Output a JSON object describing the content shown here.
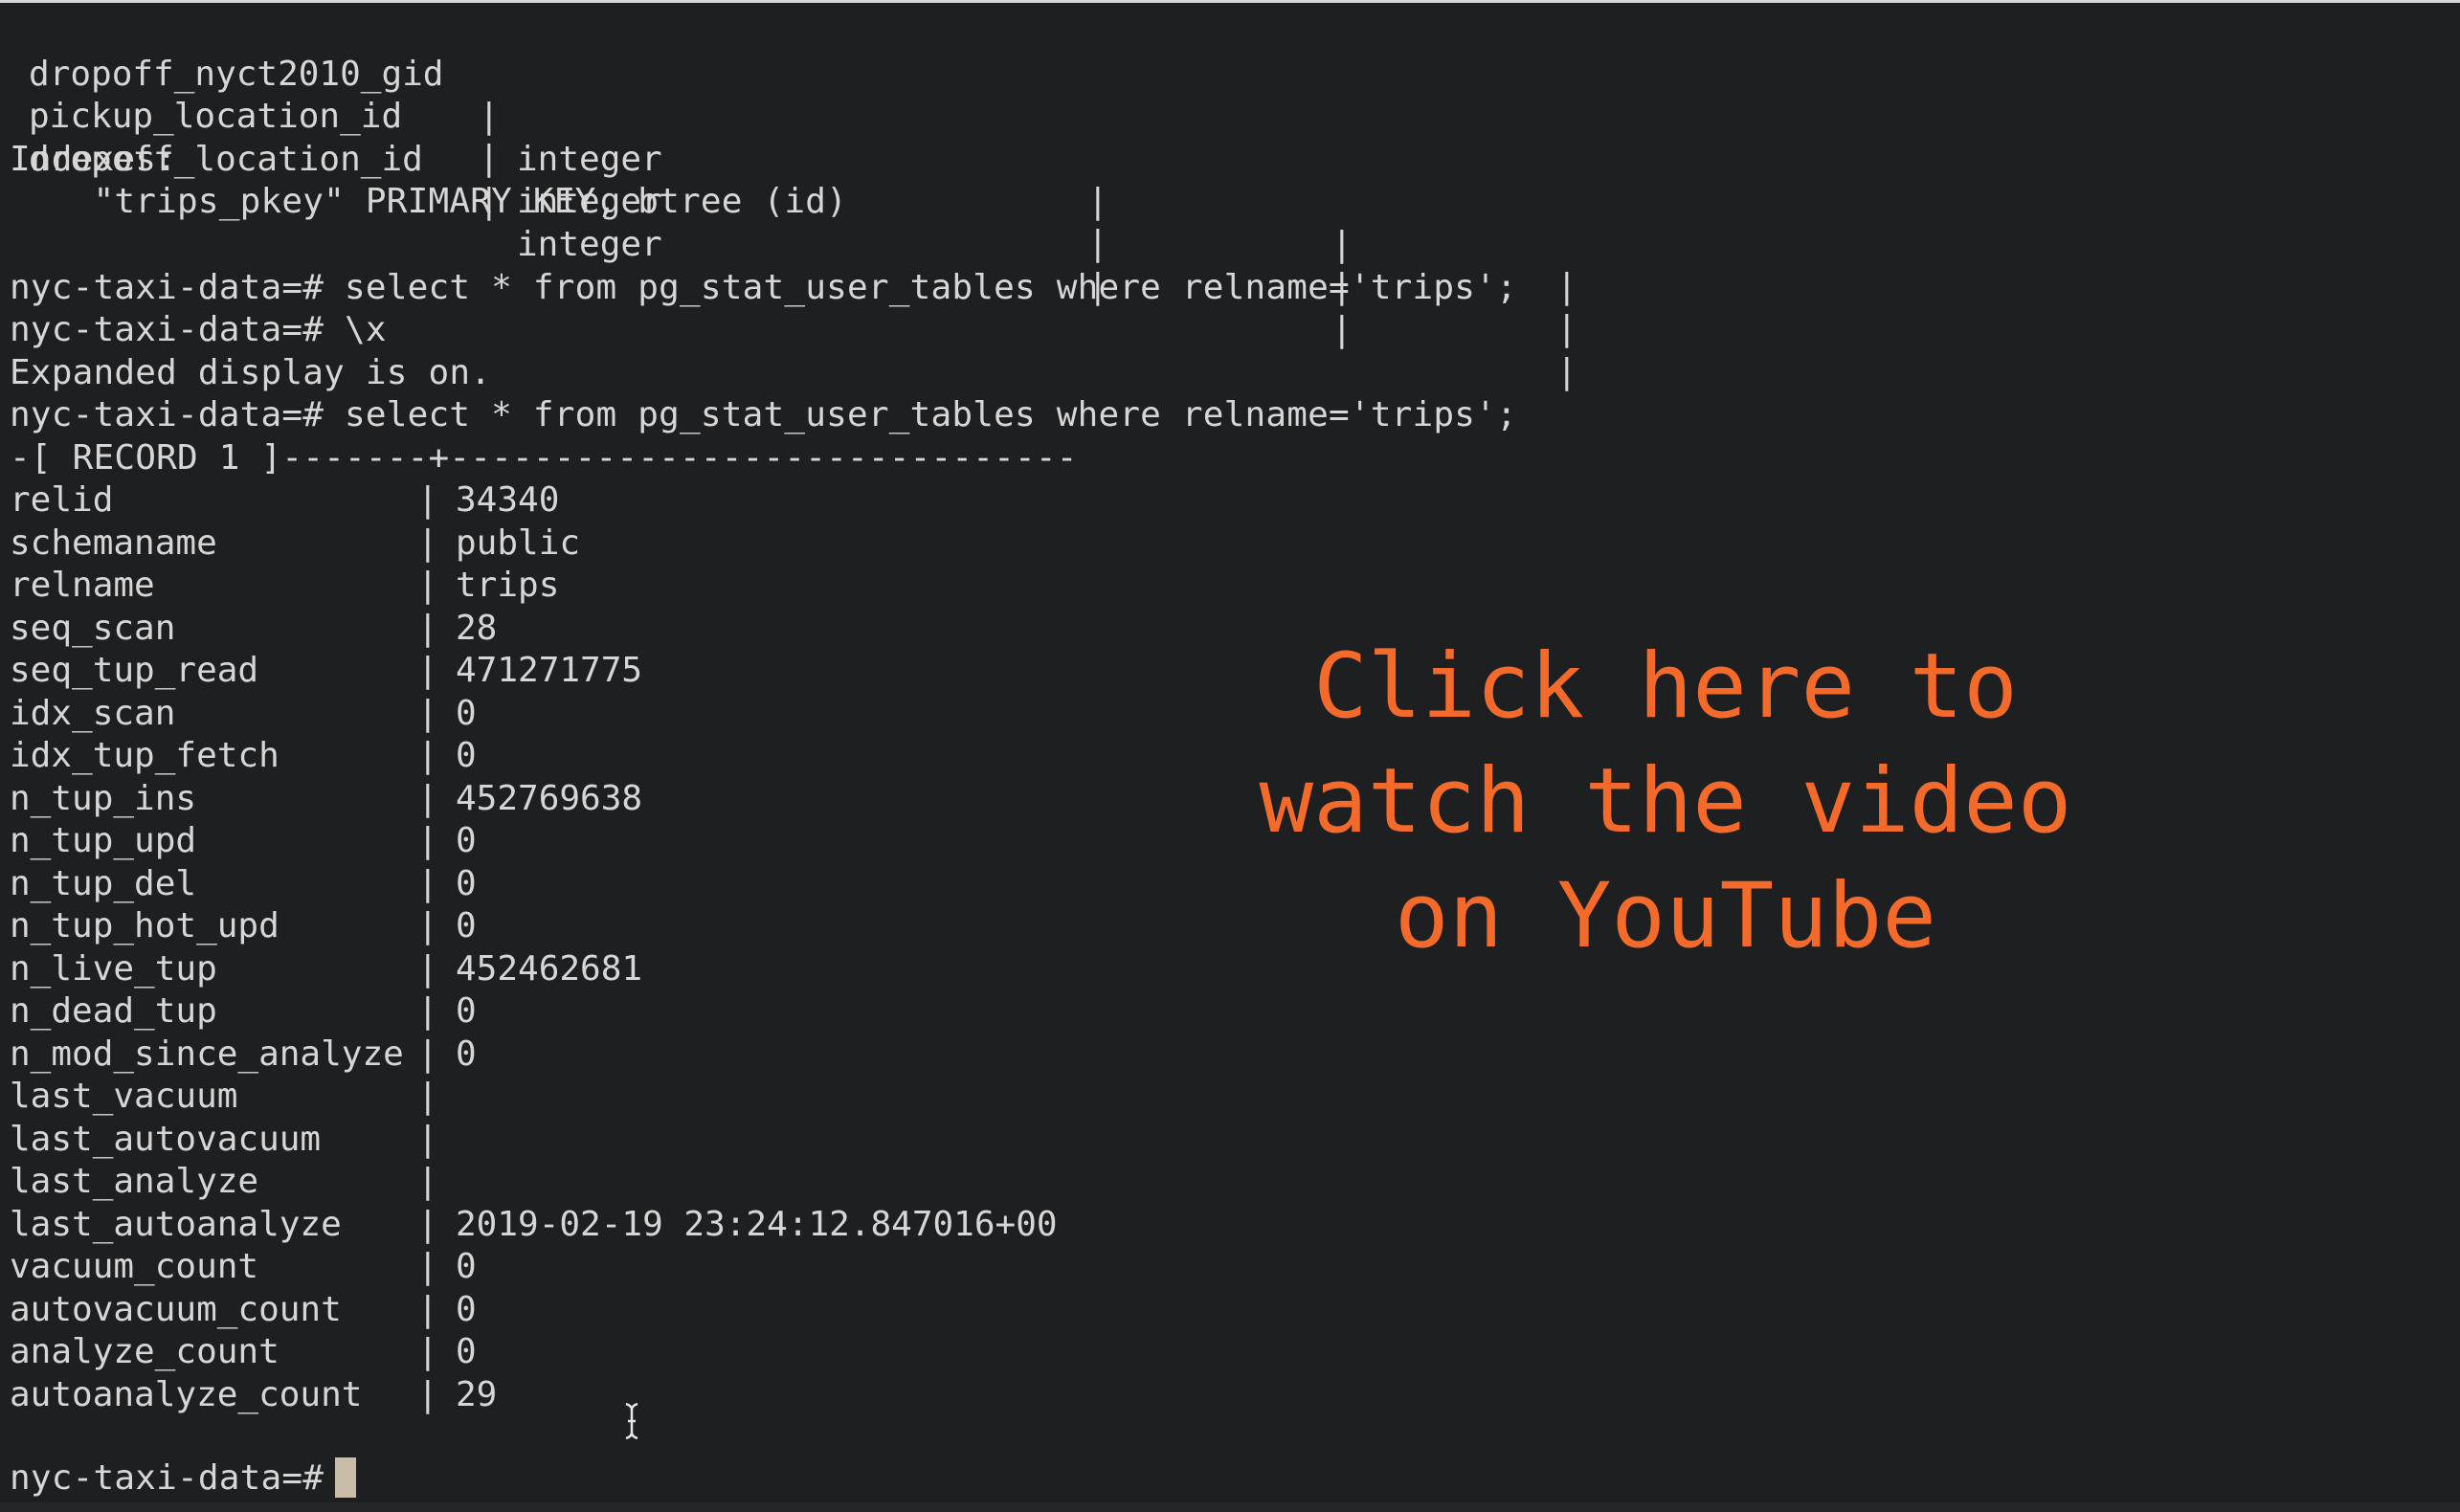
{
  "columns_table": [
    {
      "name": "dropoff_nyct2010_gid",
      "type": "integer"
    },
    {
      "name": "pickup_location_id",
      "type": "integer"
    },
    {
      "name": "dropoff_location_id",
      "type": "integer"
    }
  ],
  "column_separator": "|",
  "indexes": {
    "header": "Indexes:",
    "entry": "    \"trips_pkey\" PRIMARY KEY, btree (id)"
  },
  "commands": {
    "cmd1": "nyc-taxi-data=# select * from pg_stat_user_tables where relname='trips';",
    "cmd2": "nyc-taxi-data=# \\x",
    "msg_expanded": "Expanded display is on.",
    "cmd3": "nyc-taxi-data=# select * from pg_stat_user_tables where relname='trips';",
    "record_header": "-[ RECORD 1 ]-------+------------------------------"
  },
  "record": [
    {
      "key": "relid",
      "value": "34340"
    },
    {
      "key": "schemaname",
      "value": "public"
    },
    {
      "key": "relname",
      "value": "trips"
    },
    {
      "key": "seq_scan",
      "value": "28"
    },
    {
      "key": "seq_tup_read",
      "value": "471271775"
    },
    {
      "key": "idx_scan",
      "value": "0"
    },
    {
      "key": "idx_tup_fetch",
      "value": "0"
    },
    {
      "key": "n_tup_ins",
      "value": "452769638"
    },
    {
      "key": "n_tup_upd",
      "value": "0"
    },
    {
      "key": "n_tup_del",
      "value": "0"
    },
    {
      "key": "n_tup_hot_upd",
      "value": "0"
    },
    {
      "key": "n_live_tup",
      "value": "452462681"
    },
    {
      "key": "n_dead_tup",
      "value": "0"
    },
    {
      "key": "n_mod_since_analyze",
      "value": "0"
    },
    {
      "key": "last_vacuum",
      "value": ""
    },
    {
      "key": "last_autovacuum",
      "value": ""
    },
    {
      "key": "last_analyze",
      "value": ""
    },
    {
      "key": "last_autoanalyze",
      "value": "2019-02-19 23:24:12.847016+00"
    },
    {
      "key": "vacuum_count",
      "value": "0"
    },
    {
      "key": "autovacuum_count",
      "value": "0"
    },
    {
      "key": "analyze_count",
      "value": "0"
    },
    {
      "key": "autoanalyze_count",
      "value": "29"
    }
  ],
  "prompt": "nyc-taxi-data=# ",
  "overlay": {
    "line1": "Click here to",
    "line2": "watch the video",
    "line3": "on YouTube"
  },
  "colors": {
    "background": "#1e1f21",
    "text": "#d6d6d6",
    "overlay_text": "#f36a2a",
    "cursor": "#c9bca8"
  },
  "icons": {
    "text_cursor": "i-beam-icon",
    "terminal_cursor": "block-cursor"
  }
}
